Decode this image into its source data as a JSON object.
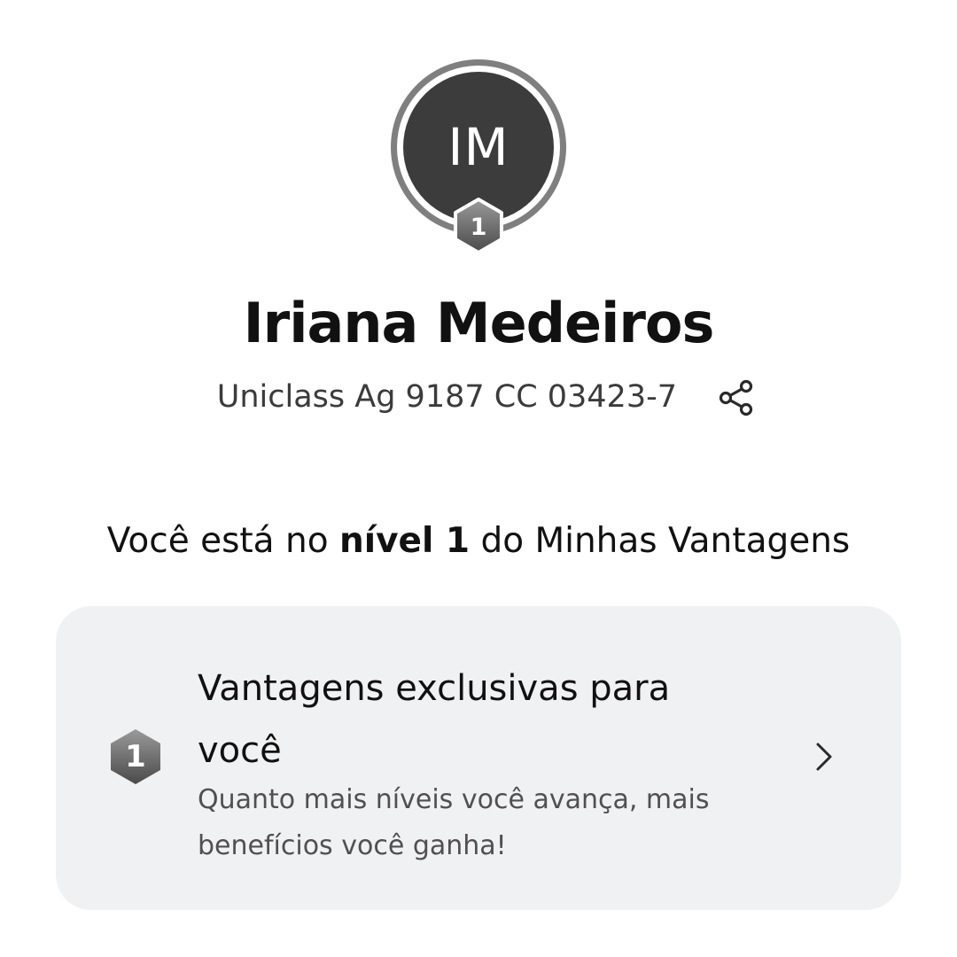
{
  "profile": {
    "initials": "IM",
    "level_badge": "1",
    "name": "Iriana Medeiros",
    "account": "Uniclass Ag 9187 CC 03423-7",
    "share_icon": "share-icon"
  },
  "level_message": {
    "prefix": "Você está no ",
    "level": "nível 1",
    "suffix": " do Minhas Vantagens"
  },
  "benefits_card": {
    "badge": "1",
    "title": "Vantagens exclusivas para você",
    "subtitle": "Quanto mais níveis você avança, mais benefícios você ganha!",
    "chevron_icon": "chevron-right-icon"
  },
  "colors": {
    "avatar_bg": "#3c3c3c",
    "avatar_ring": "#7f7f7f",
    "card_bg": "#f0f1f3",
    "badge_dark": "#4a4a4a",
    "badge_light": "#9a9a9a"
  }
}
